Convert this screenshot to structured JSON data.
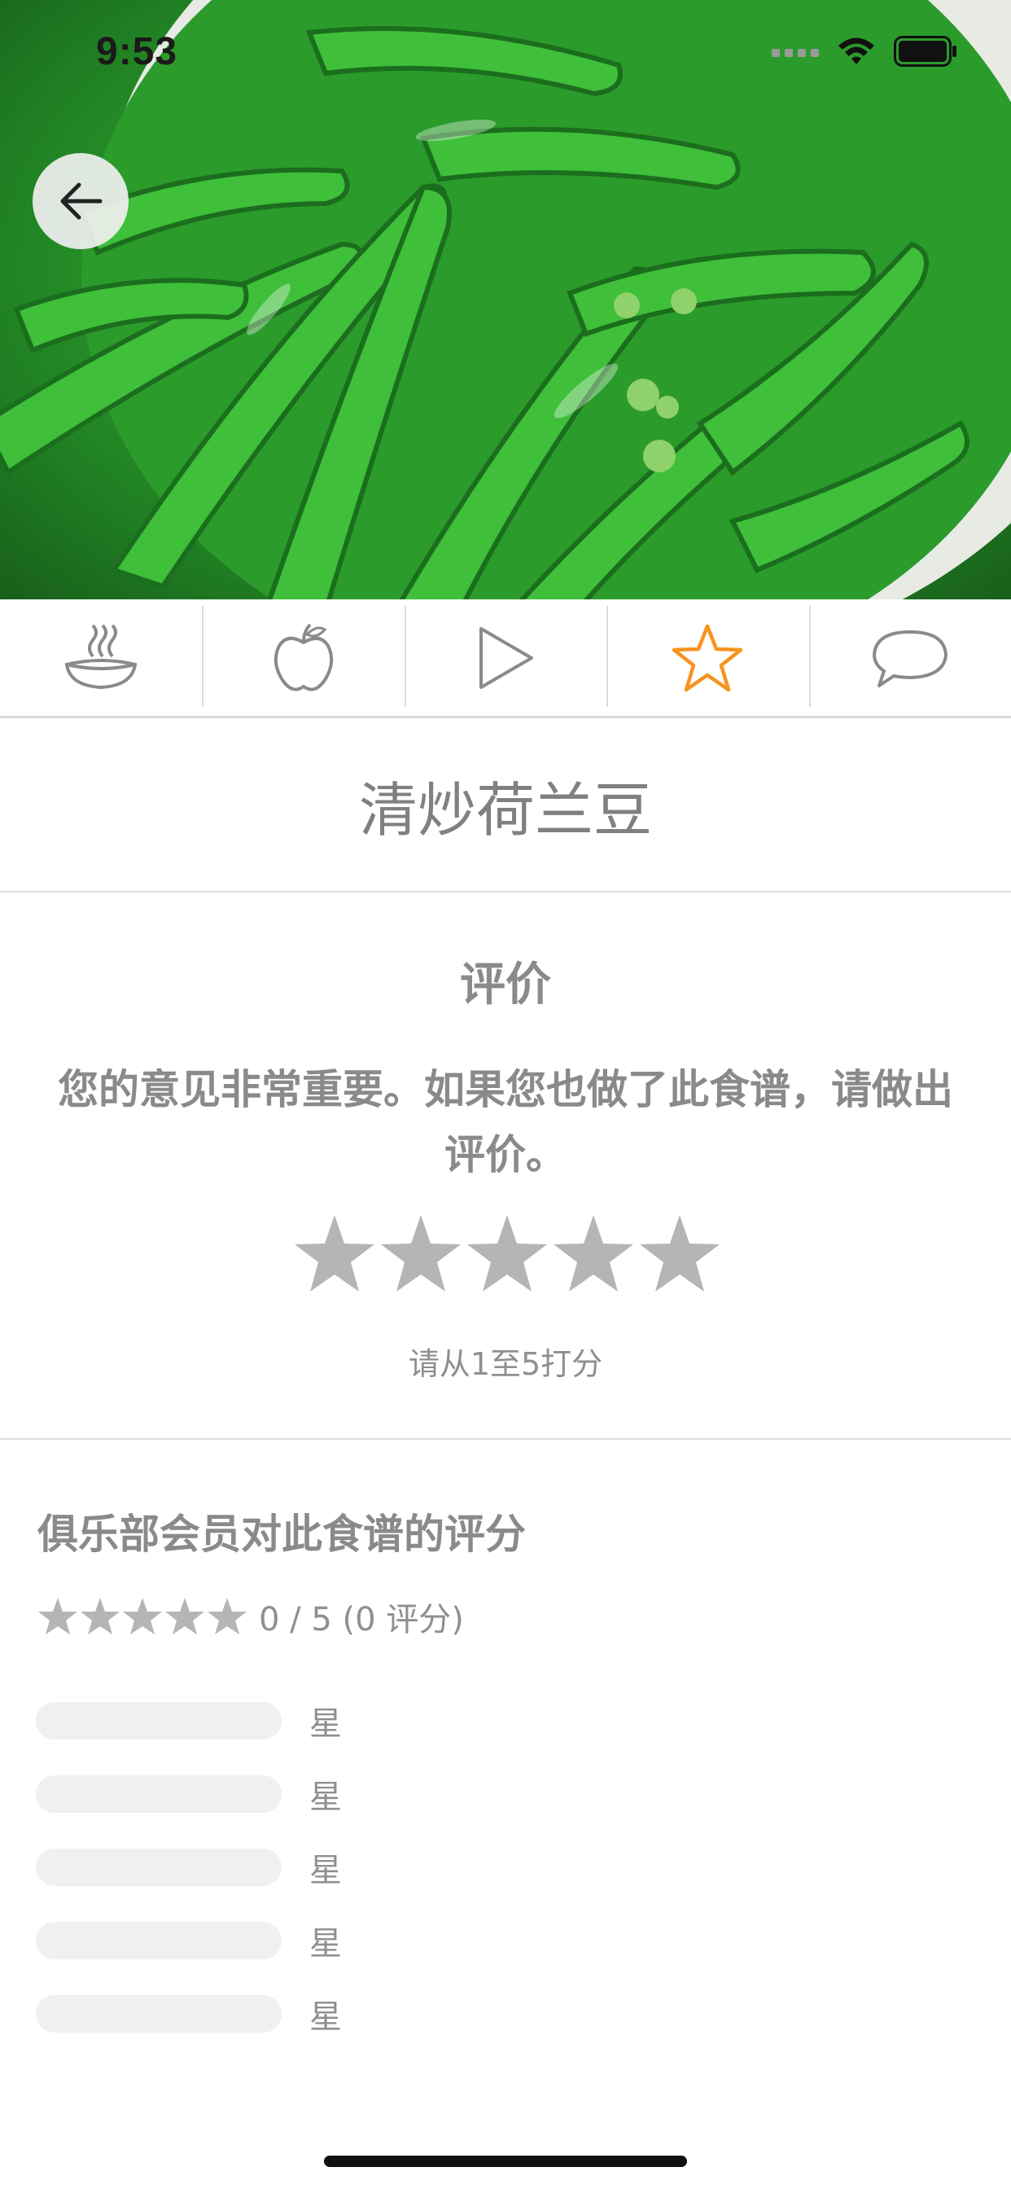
{
  "status_bar": {
    "time": "9:53"
  },
  "recipe": {
    "title": "清炒荷兰豆"
  },
  "tabs": [
    {
      "icon": "dish-icon",
      "active": false
    },
    {
      "icon": "apple-icon",
      "active": false
    },
    {
      "icon": "play-icon",
      "active": false
    },
    {
      "icon": "star-icon",
      "active": true
    },
    {
      "icon": "comment-icon",
      "active": false
    }
  ],
  "review": {
    "heading": "评价",
    "description": "您的意见非常重要。如果您也做了此食谱，请做出评价。",
    "star_count": 5,
    "hint": "请从1至5打分"
  },
  "members_rating": {
    "heading": "俱乐部会员对此食谱的评分",
    "summary": "0 / 5 (0 评分)",
    "average": 0,
    "bars": [
      {
        "label": "星",
        "fraction": 0
      },
      {
        "label": "星",
        "fraction": 0
      },
      {
        "label": "星",
        "fraction": 0
      },
      {
        "label": "星",
        "fraction": 0
      },
      {
        "label": "星",
        "fraction": 0
      }
    ]
  },
  "colors": {
    "accent": "#f7931e",
    "icon_gray": "#8a8a8a",
    "star_gray": "#b5b5b5",
    "bar_bg": "#f0f0f0"
  }
}
